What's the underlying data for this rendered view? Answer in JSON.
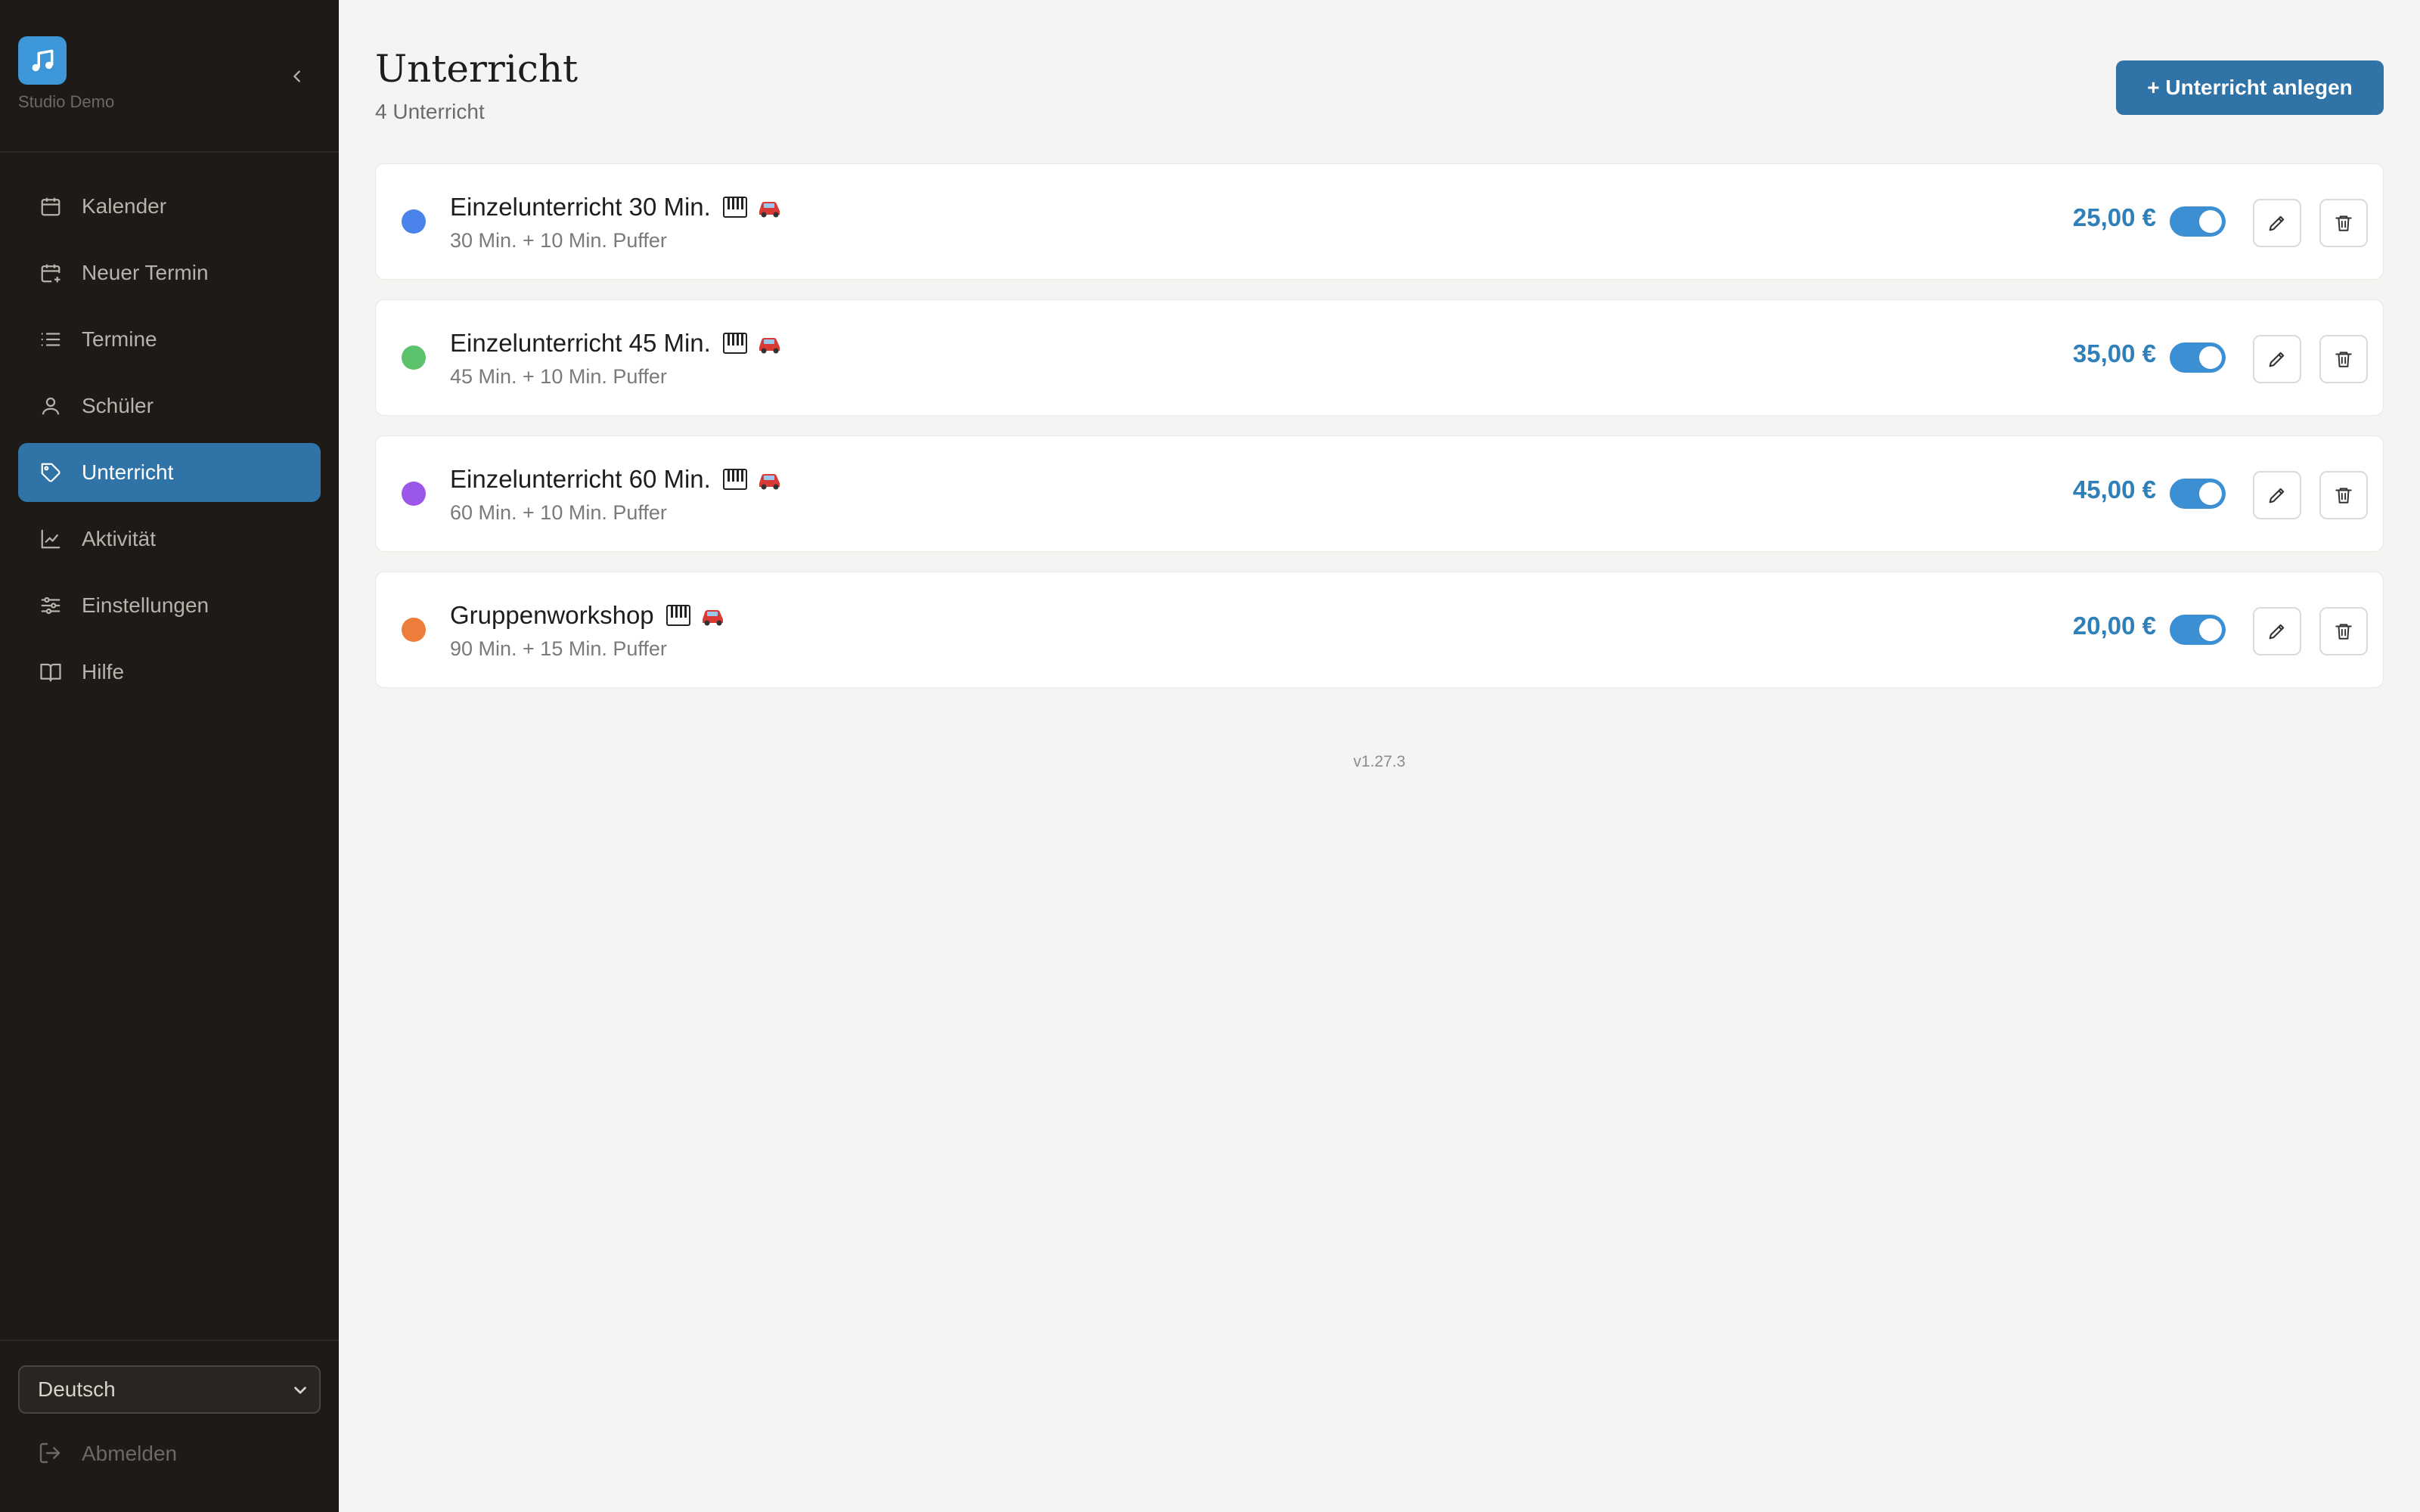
{
  "sidebar": {
    "studio_name": "Studio Demo",
    "nav": [
      {
        "label": "Kalender",
        "icon": "calendar-icon",
        "active": false
      },
      {
        "label": "Neuer Termin",
        "icon": "calendar-plus-icon",
        "active": false
      },
      {
        "label": "Termine",
        "icon": "list-icon",
        "active": false
      },
      {
        "label": "Schüler",
        "icon": "user-icon",
        "active": false
      },
      {
        "label": "Unterricht",
        "icon": "tag-icon",
        "active": true
      },
      {
        "label": "Aktivität",
        "icon": "chart-line-icon",
        "active": false
      },
      {
        "label": "Einstellungen",
        "icon": "sliders-icon",
        "active": false
      },
      {
        "label": "Hilfe",
        "icon": "book-icon",
        "active": false
      }
    ],
    "language": "Deutsch",
    "logout_label": "Abmelden"
  },
  "header": {
    "title": "Unterricht",
    "subtitle": "4 Unterricht",
    "add_button": "+ Unterricht anlegen"
  },
  "lessons": [
    {
      "title": "Einzelunterricht 30 Min.",
      "sub": "30 Min. + 10 Min. Puffer",
      "price": "25,00 €",
      "color": "#4a84ea",
      "enabled": true
    },
    {
      "title": "Einzelunterricht 45 Min.",
      "sub": "45 Min. + 10 Min. Puffer",
      "price": "35,00 €",
      "color": "#5cc26c",
      "enabled": true
    },
    {
      "title": "Einzelunterricht 60 Min.",
      "sub": "60 Min. + 10 Min. Puffer",
      "price": "45,00 €",
      "color": "#9b57ea",
      "enabled": true
    },
    {
      "title": "Gruppenworkshop",
      "sub": "90 Min. + 15 Min. Puffer",
      "price": "20,00 €",
      "color": "#ec7d3a",
      "enabled": true
    }
  ],
  "colors": {
    "sidebar_bg": "#1e1a17",
    "accent": "#2f73a7",
    "price": "#2f7fb9",
    "toggle_on": "#3c8fd3"
  },
  "footer": {
    "version": "v1.27.3"
  }
}
